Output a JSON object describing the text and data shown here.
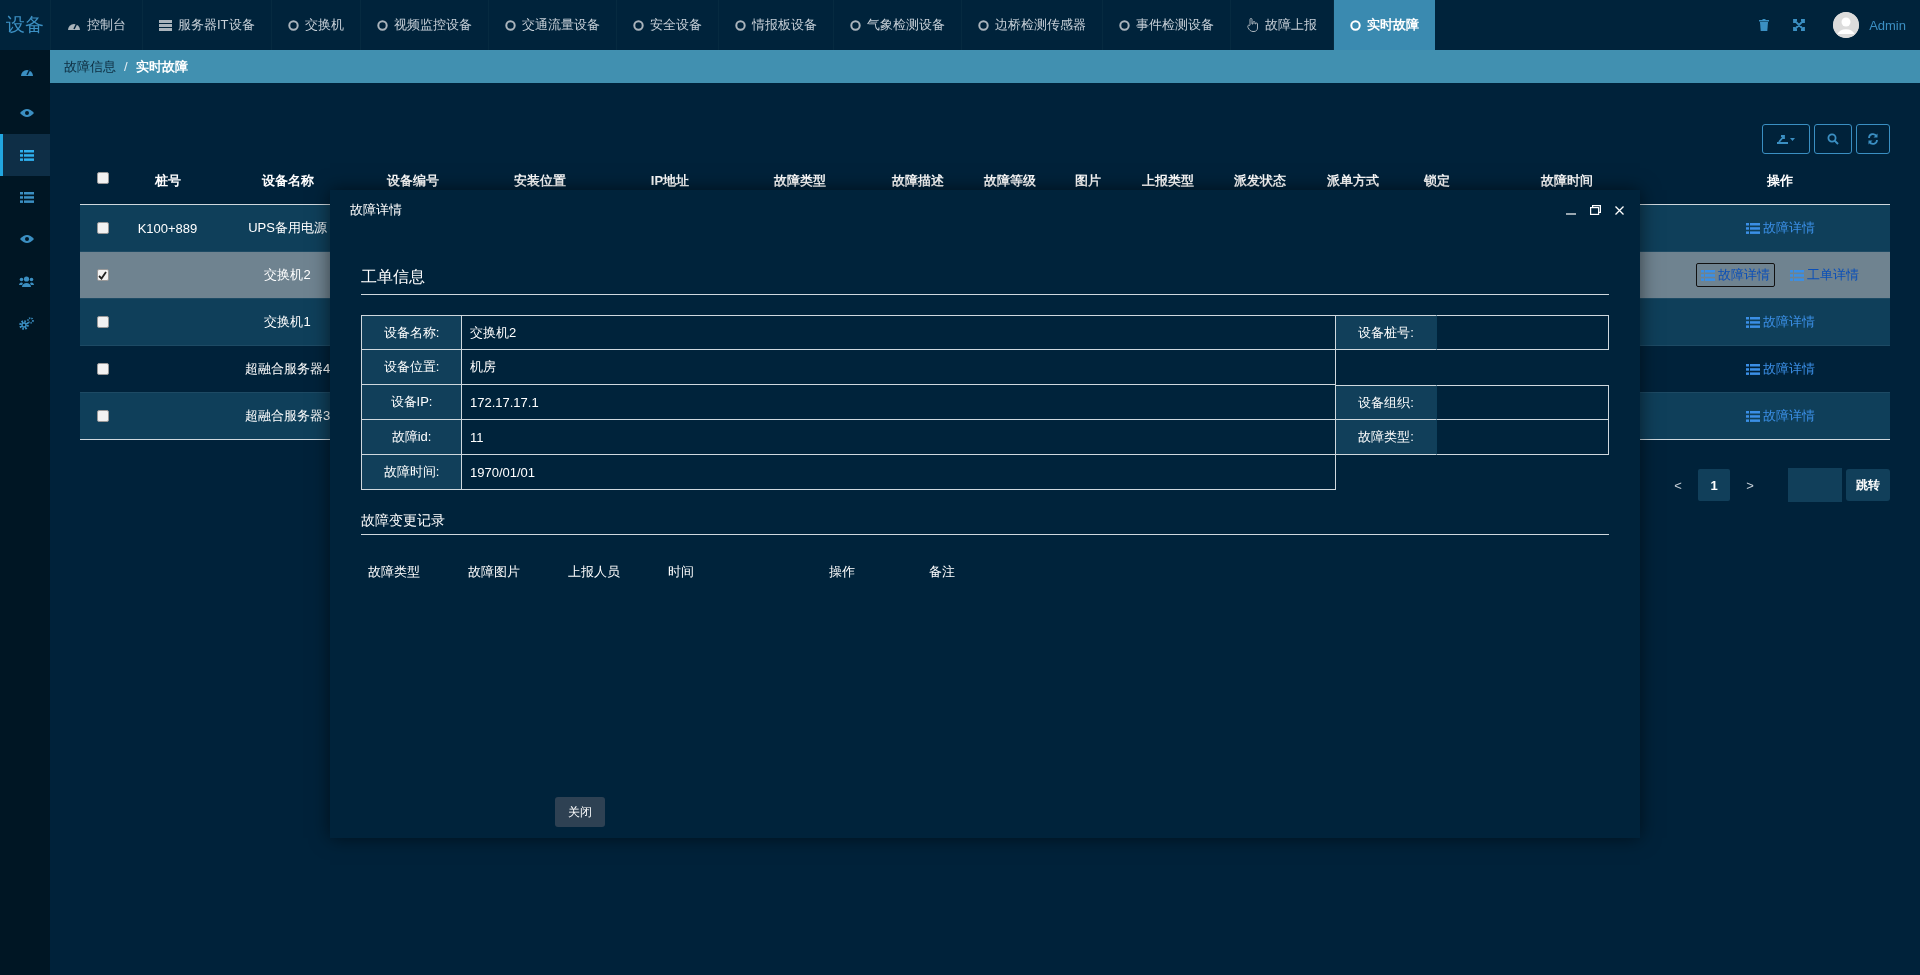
{
  "brand": "设备",
  "nav": [
    {
      "label": "控制台",
      "kind": "dashboard",
      "selected": false
    },
    {
      "label": "服务器IT设备",
      "kind": "server",
      "selected": false
    },
    {
      "label": "交换机",
      "kind": "circle",
      "selected": false
    },
    {
      "label": "视频监控设备",
      "kind": "circle",
      "selected": false
    },
    {
      "label": "交通流量设备",
      "kind": "circle",
      "selected": false
    },
    {
      "label": "安全设备",
      "kind": "circle",
      "selected": false
    },
    {
      "label": "情报板设备",
      "kind": "circle",
      "selected": false
    },
    {
      "label": "气象检测设备",
      "kind": "circle",
      "selected": false
    },
    {
      "label": "边桥检测传感器",
      "kind": "circle",
      "selected": false
    },
    {
      "label": "事件检测设备",
      "kind": "circle",
      "selected": false
    },
    {
      "label": "故障上报",
      "kind": "hand",
      "selected": false
    },
    {
      "label": "实时故障",
      "kind": "circle",
      "selected": true
    }
  ],
  "user": {
    "name": "Admin"
  },
  "sidebar": [
    {
      "kind": "dashboard",
      "selected": false
    },
    {
      "kind": "eye",
      "selected": false
    },
    {
      "kind": "list",
      "selected": true
    },
    {
      "kind": "list",
      "selected": false
    },
    {
      "kind": "eye",
      "selected": false
    },
    {
      "kind": "users",
      "selected": false
    },
    {
      "kind": "gears",
      "selected": false
    }
  ],
  "breadcrumb": {
    "items": [
      "故障信息",
      "实时故障"
    ],
    "separator": "/"
  },
  "table": {
    "columns": [
      "桩号",
      "设备名称",
      "设备编号",
      "安装位置",
      "IP地址",
      "故障类型",
      "故障描述",
      "故障等级",
      "图片",
      "上报类型",
      "派发状态",
      "派单方式",
      "锁定",
      "故障时间",
      "操作"
    ],
    "header_checked": false,
    "rows": [
      {
        "checked": false,
        "pile": "K100+889",
        "name": "UPS备用电源",
        "actions": [
          {
            "label": "故障详情",
            "focused": false
          }
        ]
      },
      {
        "checked": true,
        "name": "交换机2",
        "actions": [
          {
            "label": "故障详情",
            "focused": true
          },
          {
            "label": "工单详情",
            "focused": false
          }
        ]
      },
      {
        "checked": false,
        "name": "交换机1",
        "actions": [
          {
            "label": "故障详情",
            "focused": false
          }
        ]
      },
      {
        "checked": false,
        "name": "超融合服务器4",
        "actions": [
          {
            "label": "故障详情",
            "focused": false
          }
        ]
      },
      {
        "checked": false,
        "name": "超融合服务器3",
        "actions": [
          {
            "label": "故障详情",
            "focused": false
          }
        ]
      }
    ]
  },
  "pagination": {
    "prev": "<",
    "pages": [
      {
        "label": "1",
        "selected": true
      }
    ],
    "next": ">",
    "jump": "跳转"
  },
  "modal": {
    "title": "故障详情",
    "work_order": {
      "title": "工单信息",
      "rows": [
        {
          "left": {
            "label": "设备名称:",
            "value": "交换机2"
          },
          "right": {
            "label": "设备桩号:"
          }
        },
        {
          "left": {
            "label": "设备位置:",
            "value": "机房"
          }
        },
        {
          "left": {
            "label": "设备IP:",
            "value": "172.17.17.1"
          },
          "right": {
            "label": "设备组织:"
          }
        },
        {
          "left": {
            "label": "故障id:",
            "value": "11"
          },
          "right": {
            "label": "故障类型:"
          }
        },
        {
          "left": {
            "label": "故障时间:",
            "value": "1970/01/01"
          }
        }
      ]
    },
    "history": {
      "title": "故障变更记录",
      "columns": [
        "故障类型",
        "故障图片",
        "上报人员",
        "时间",
        "操作",
        "备注"
      ]
    },
    "close": "关闭"
  }
}
